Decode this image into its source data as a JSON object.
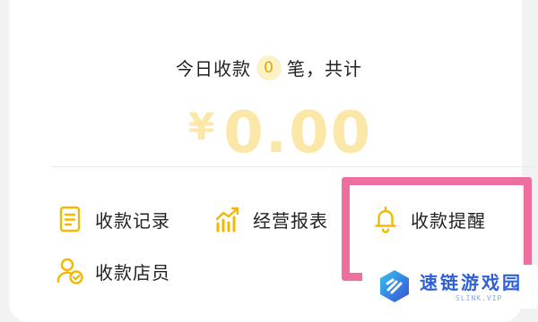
{
  "summary": {
    "prefix": "今日收款",
    "count": "0",
    "suffix": "笔，共计"
  },
  "amount": {
    "currency": "¥",
    "value": "0.00"
  },
  "menu": {
    "records": "收款记录",
    "reports": "经营报表",
    "reminder": "收款提醒",
    "clerk": "收款店员"
  },
  "watermark": {
    "brand": "速链游戏园",
    "sub": "SLINK.VIP"
  },
  "colors": {
    "accent": "#f5b800",
    "amount": "#fbe7a8",
    "highlight": "#ef6ea0",
    "watermark": "#2d5fd8"
  },
  "icons": {
    "records": "document-list-icon",
    "reports": "chart-growth-icon",
    "reminder": "bell-icon",
    "clerk": "user-check-icon"
  }
}
